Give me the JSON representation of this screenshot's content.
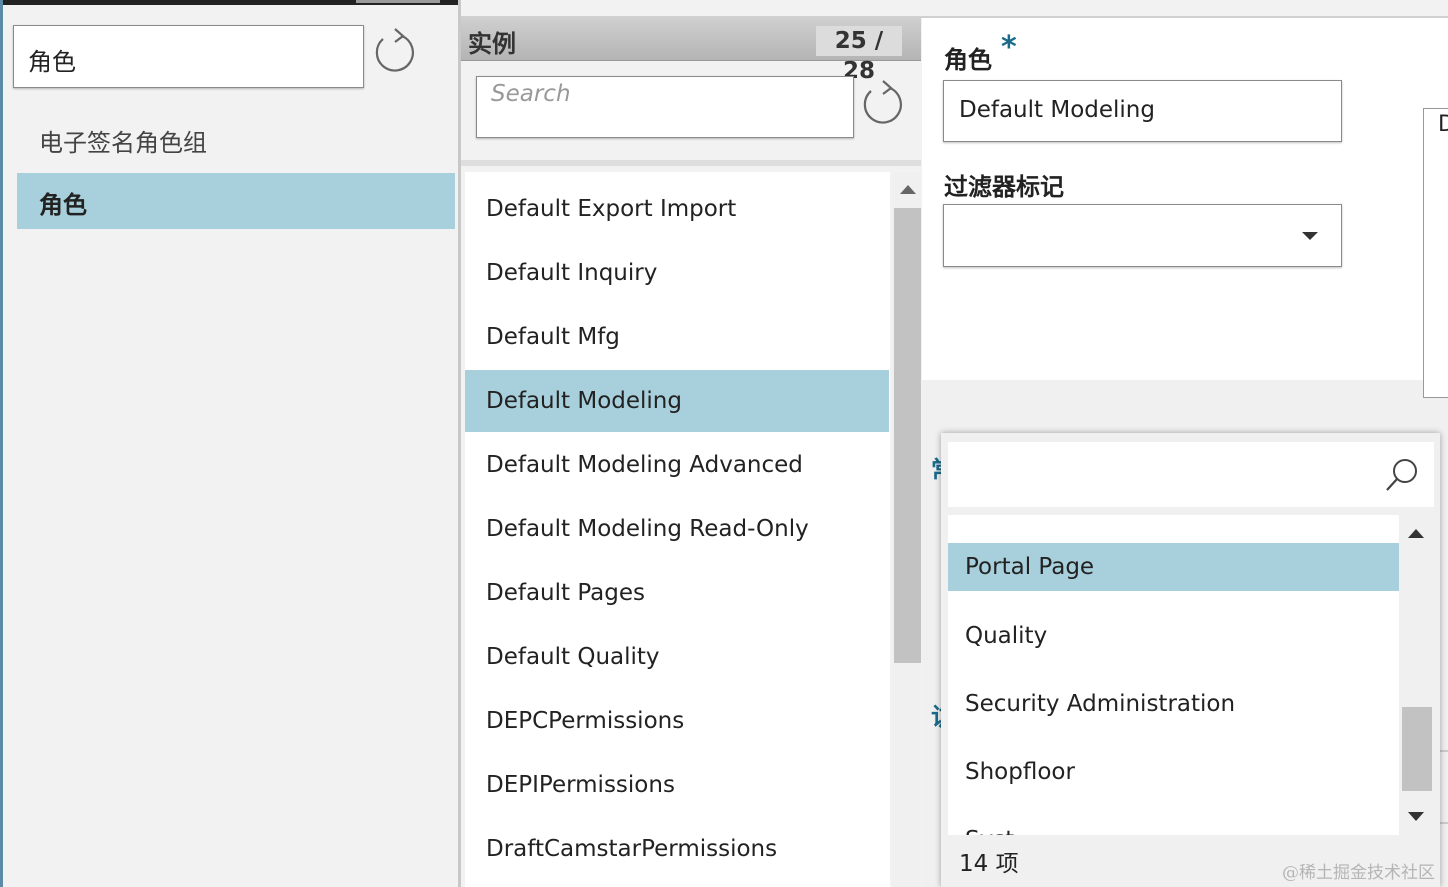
{
  "left_panel": {
    "search_value": "角色",
    "items": [
      {
        "label": "电子签名角色组",
        "selected": false
      },
      {
        "label": "角色",
        "selected": true
      }
    ]
  },
  "middle_panel": {
    "title": "实例",
    "count": "25 / 28",
    "search_placeholder": "Search",
    "items": [
      {
        "label": "Default Export Import",
        "selected": false
      },
      {
        "label": "Default Inquiry",
        "selected": false
      },
      {
        "label": "Default Mfg",
        "selected": false
      },
      {
        "label": "Default Modeling",
        "selected": true
      },
      {
        "label": "Default Modeling Advanced",
        "selected": false
      },
      {
        "label": "Default Modeling Read-Only",
        "selected": false
      },
      {
        "label": "Default Pages",
        "selected": false
      },
      {
        "label": "Default Quality",
        "selected": false
      },
      {
        "label": "DEPCPermissions",
        "selected": false
      },
      {
        "label": "DEPIPermissions",
        "selected": false
      },
      {
        "label": "DraftCamstarPermissions",
        "selected": false
      }
    ]
  },
  "detail_panel": {
    "role_label": "角色",
    "required_marker": "*",
    "role_value": "Default Modeling",
    "filter_label": "过滤器标记",
    "filter_value": "",
    "side_box_text": "D",
    "partial_label_1": "常",
    "partial_label_2": "访"
  },
  "dropdown_popup": {
    "search_value": "",
    "items": [
      {
        "label": "Portal Page",
        "selected": true
      },
      {
        "label": "Quality",
        "selected": false
      },
      {
        "label": "Security Administration",
        "selected": false
      },
      {
        "label": "Shopfloor",
        "selected": false
      },
      {
        "label": "Syst",
        "selected": false
      }
    ],
    "count_label": "14 项"
  },
  "watermark": "@稀土掘金技术社区",
  "colors": {
    "selection": "#a8cfdc",
    "accent": "#1a6a8a"
  },
  "icons": {
    "refresh": "refresh-icon",
    "search": "search-icon",
    "dropdown": "caret-down-icon"
  }
}
